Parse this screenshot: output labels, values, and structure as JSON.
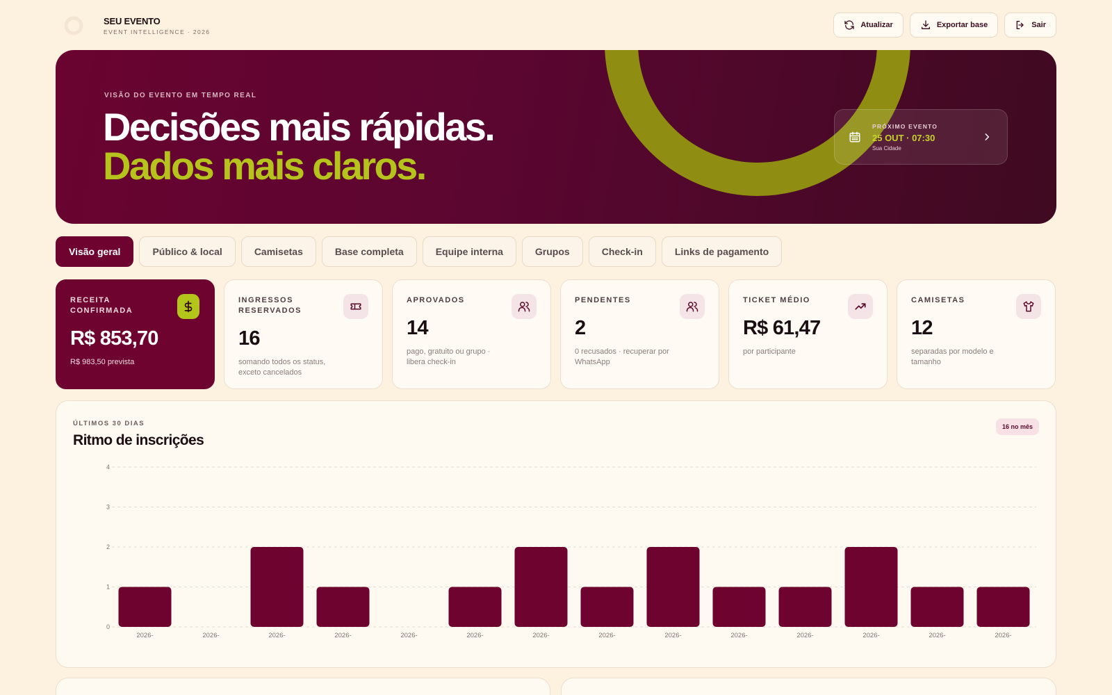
{
  "brand": {
    "name": "SEU EVENTO",
    "subtitle": "EVENT INTELLIGENCE · 2026"
  },
  "actions": [
    {
      "label": "Atualizar",
      "icon": "refresh-icon"
    },
    {
      "label": "Exportar base",
      "icon": "download-icon"
    },
    {
      "label": "Sair",
      "icon": "logout-icon"
    }
  ],
  "hero": {
    "eyebrow": "VISÃO DO EVENTO EM TEMPO REAL",
    "line1": "Decisões mais rápidas.",
    "line2": "Dados mais claros.",
    "next_event": {
      "label": "PRÓXIMO EVENTO",
      "date": "25 OUT · 07:30",
      "city": "Sua Cidade"
    }
  },
  "tabs": [
    "Visão geral",
    "Público & local",
    "Camisetas",
    "Base completa",
    "Equipe interna",
    "Grupos",
    "Check-in",
    "Links de pagamento"
  ],
  "kpis": [
    {
      "label": "RECEITA CONFIRMADA",
      "value": "R$ 853,70",
      "sub": "R$ 983,50 prevista",
      "icon": "dollar-icon"
    },
    {
      "label": "INGRESSOS RESERVADOS",
      "value": "16",
      "sub": "somando todos os status, exceto cancelados",
      "icon": "ticket-icon"
    },
    {
      "label": "APROVADOS",
      "value": "14",
      "sub": "pago, gratuito ou grupo · libera check-in",
      "icon": "users-icon"
    },
    {
      "label": "PENDENTES",
      "value": "2",
      "sub": "0 recusados · recuperar por WhatsApp",
      "icon": "users-icon"
    },
    {
      "label": "TICKET MÉDIO",
      "value": "R$ 61,47",
      "sub": "por participante",
      "icon": "trending-up-icon"
    },
    {
      "label": "CAMISETAS",
      "value": "12",
      "sub": "separadas por modelo e tamanho",
      "icon": "shirt-icon"
    }
  ],
  "panel": {
    "eyebrow": "ÚLTIMOS 30 DIAS",
    "title": "Ritmo de inscrições",
    "badge": "16 no mês"
  },
  "colors": {
    "primary": "#6e0330",
    "accent": "#b3c51a",
    "background": "#fdf1df"
  },
  "chart_data": {
    "type": "bar",
    "categories": [
      "2026-",
      "2026-",
      "2026-",
      "2026-",
      "2026-",
      "2026-",
      "2026-",
      "2026-",
      "2026-",
      "2026-",
      "2026-",
      "2026-",
      "2026-",
      "2026-"
    ],
    "values": [
      1,
      0,
      2,
      1,
      0,
      1,
      2,
      1,
      2,
      1,
      1,
      2,
      1,
      1
    ],
    "ylim": [
      0,
      4
    ],
    "yticks": [
      0,
      1,
      2,
      3,
      4
    ],
    "grid": true,
    "bar_color": "#6e0330"
  }
}
